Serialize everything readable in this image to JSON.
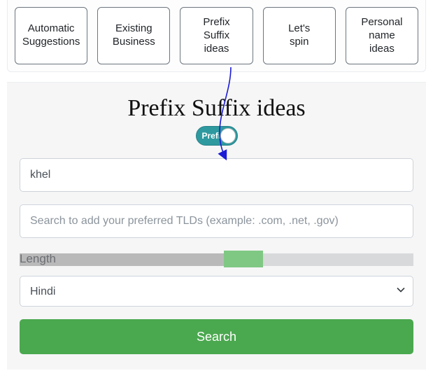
{
  "tabs": [
    {
      "label": "Automatic\nSuggestions"
    },
    {
      "label": "Existing\nBusiness"
    },
    {
      "label": "Prefix\nSuffix\nideas"
    },
    {
      "label": "Let's\nspin"
    },
    {
      "label": "Personal\nname\nideas"
    }
  ],
  "panel": {
    "title": "Prefix Suffix ideas",
    "toggle_label": "Prefi",
    "keyword_value": "khel",
    "tld_placeholder": "Search to add your preferred TLDs (example: .com, .net, .gov)",
    "length_label": "Length",
    "language_selected": "Hindi",
    "search_label": "Search"
  }
}
